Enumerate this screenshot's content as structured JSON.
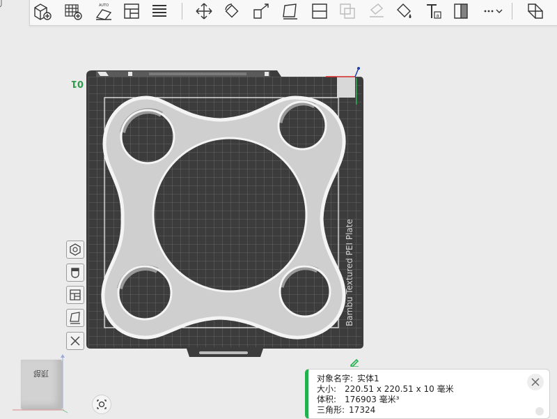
{
  "viewport": {
    "plate_name": "Bambu Textured PEI Plate",
    "plate_number": "01"
  },
  "nav_cube": {
    "face_label": "顶部"
  },
  "object_info": {
    "name_label": "对象名字:",
    "name_value": "实体1",
    "size_label": "大小:",
    "size_value": "220.51 x 220.51 x 10 毫米",
    "volume_label": "体积:",
    "volume_value": "176903 毫米³",
    "triangles_label": "三角形:",
    "triangles_value": "17324"
  },
  "toolbar": {
    "more_glyph": "···"
  },
  "colors": {
    "plate": "#3e3e3e",
    "grid": "#6f6f6f",
    "model": "#cfcfcf",
    "accent": "#22b14c"
  }
}
